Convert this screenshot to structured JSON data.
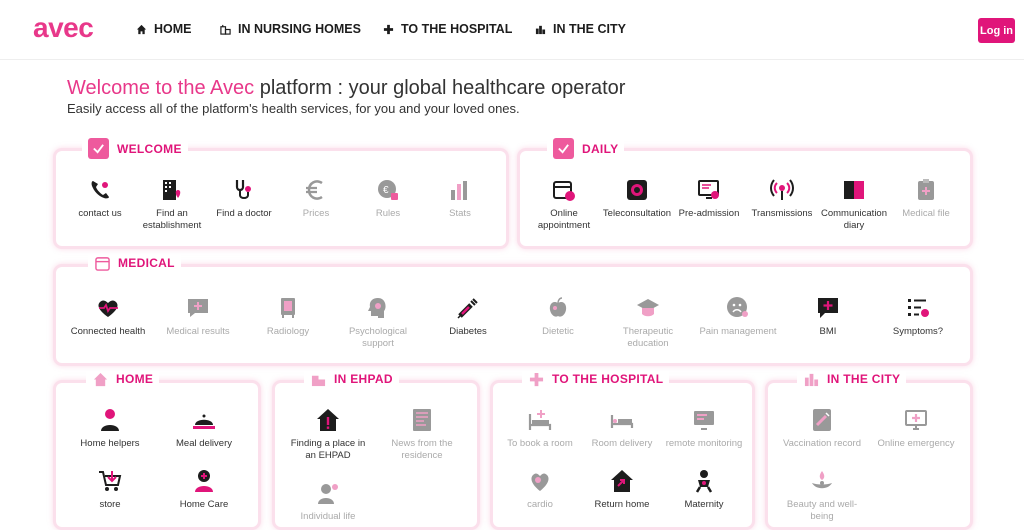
{
  "header": {
    "logo": "avec",
    "nav": [
      {
        "label": "HOME",
        "icon": "home-icon"
      },
      {
        "label": "IN NURSING HOMES",
        "icon": "building-icon"
      },
      {
        "label": "TO THE HOSPITAL",
        "icon": "plus-icon"
      },
      {
        "label": "IN THE CITY",
        "icon": "city-icon"
      }
    ],
    "login_label": "Log in"
  },
  "intro": {
    "title_pink": "Welcome to the Avec",
    "title_rest": " platform : your global healthcare operator",
    "subtitle": "Easily access all of the platform's health services, for you and your loved ones."
  },
  "sections": {
    "welcome": {
      "title": "WELCOME",
      "items": [
        "contact us",
        "Find an establishment",
        "Find a doctor",
        "Prices",
        "Rules",
        "Stats"
      ]
    },
    "daily": {
      "title": "DAILY",
      "items": [
        "Online appointment",
        "Teleconsultation",
        "Pre-admission",
        "Transmissions",
        "Communication diary",
        "Medical file"
      ]
    },
    "medical": {
      "title": "MEDICAL",
      "items": [
        "Connected health",
        "Medical results",
        "Radiology",
        "Psychological support",
        "Diabetes",
        "Dietetic",
        "Therapeutic education",
        "Pain management",
        "BMI",
        "Symptoms?"
      ]
    },
    "home": {
      "title": "HOME",
      "items": [
        "Home helpers",
        "Meal delivery",
        "store",
        "Home Care"
      ]
    },
    "ehpad": {
      "title": "IN EHPAD",
      "items": [
        "Finding a place in an EHPAD",
        "News from the residence",
        "Individual life"
      ]
    },
    "hospital": {
      "title": "TO THE HOSPITAL",
      "items": [
        "To book a room",
        "Room delivery",
        "remote monitoring",
        "cardio",
        "Return home",
        "Maternity"
      ]
    },
    "city": {
      "title": "IN THE CITY",
      "items": [
        "Vaccination record",
        "Online emergency",
        "Beauty and well-being"
      ]
    }
  },
  "colors": {
    "accent": "#e0157a",
    "accent_light": "#ee5a9d",
    "card_border": "#fbe0ec",
    "dim_text": "#aaaaaa"
  }
}
